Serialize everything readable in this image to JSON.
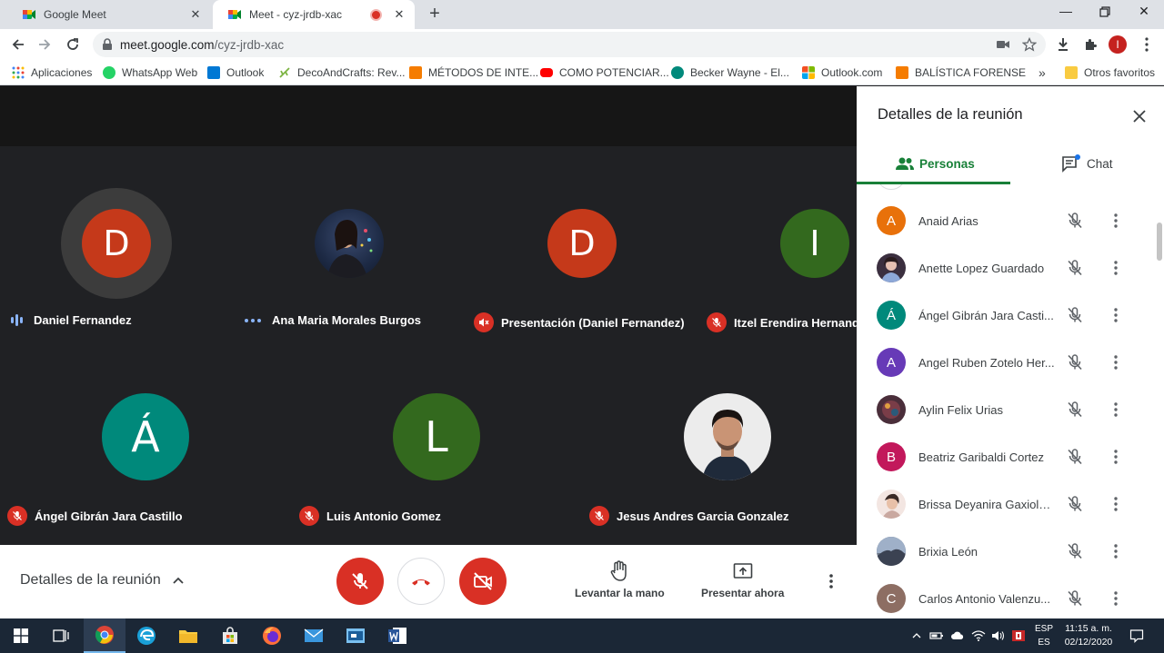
{
  "browser": {
    "tabs": [
      {
        "title": "Google Meet",
        "active": false
      },
      {
        "title": "Meet - cyz-jrdb-xac",
        "active": true,
        "recording": true
      }
    ],
    "url_host": "meet.google.com",
    "url_path": "/cyz-jrdb-xac",
    "profile_initial": "I",
    "bookmarks": [
      {
        "label": "Aplicaciones",
        "icon": "apps-grid-icon",
        "color": "#4285f4"
      },
      {
        "label": "WhatsApp Web",
        "icon": "whatsapp-icon",
        "color": "#25d366"
      },
      {
        "label": "Outlook",
        "icon": "outlook-icon",
        "color": "#0078d4"
      },
      {
        "label": "DecoAndCrafts: Rev...",
        "icon": "leaf-icon",
        "color": "#7cb342"
      },
      {
        "label": "MÉTODOS DE INTE...",
        "icon": "blogger-icon",
        "color": "#f57c00"
      },
      {
        "label": "COMO POTENCIAR...",
        "icon": "youtube-icon",
        "color": "#ff0000"
      },
      {
        "label": "Becker Wayne - El...",
        "icon": "globe-icon",
        "color": "#00897b"
      },
      {
        "label": "Outlook.com",
        "icon": "microsoft-icon",
        "color": "#f25022"
      },
      {
        "label": "BALÍSTICA FORENSE",
        "icon": "blogger-icon",
        "color": "#f57c00"
      }
    ],
    "more_bookmarks": "»",
    "other_bookmarks": "Otros favoritos"
  },
  "meet": {
    "tiles": [
      {
        "name": "Daniel Fernandez",
        "initial": "D",
        "color": "#c5391a",
        "status": "speaking"
      },
      {
        "name": "Ana Maria Morales Burgos",
        "initial": "",
        "color": "#243355",
        "status": "dots"
      },
      {
        "name": "Presentación (Daniel Fernandez)",
        "initial": "D",
        "color": "#c5391a",
        "status": "muted-presentation"
      },
      {
        "name": "Itzel Erendira Hernandez",
        "initial": "I",
        "color": "#33691e",
        "status": "muted"
      },
      {
        "name": "Ángel Gibrán Jara Castillo",
        "initial": "Á",
        "color": "#00897b",
        "status": "muted"
      },
      {
        "name": "Luis Antonio Gomez",
        "initial": "L",
        "color": "#33691e",
        "status": "muted"
      },
      {
        "name": "Jesus Andres Garcia Gonzalez",
        "initial": "",
        "color": "#e8e8e8",
        "status": "muted"
      }
    ],
    "controls": {
      "details_label": "Detalles de la reunión",
      "raise_hand_label": "Levantar la mano",
      "present_label": "Presentar ahora"
    }
  },
  "panel": {
    "title": "Detalles de la reunión",
    "tab_people": "Personas",
    "tab_chat": "Chat",
    "people": [
      {
        "name": "Anaid Arias",
        "initial": "A",
        "color": "#e8710a"
      },
      {
        "name": "Anette Lopez Guardado",
        "initial": "",
        "color": "#3b2f3f"
      },
      {
        "name": "Ángel Gibrán Jara Casti...",
        "initial": "Á",
        "color": "#00897b"
      },
      {
        "name": "Angel Ruben Zotelo Her...",
        "initial": "A",
        "color": "#673ab7"
      },
      {
        "name": "Aylin Felix Urias",
        "initial": "",
        "color": "#4a2e3a"
      },
      {
        "name": "Beatriz Garibaldi Cortez",
        "initial": "B",
        "color": "#c2185b"
      },
      {
        "name": "Brissa Deyanira Gaxiola ...",
        "initial": "",
        "color": "#d9c7c3"
      },
      {
        "name": "Brixia León",
        "initial": "",
        "color": "#6b7587"
      },
      {
        "name": "Carlos Antonio Valenzu...",
        "initial": "C",
        "color": "#8d6e63"
      }
    ]
  },
  "taskbar": {
    "lang_line1": "ESP",
    "lang_line2": "ES",
    "time": "11:15 a. m.",
    "date": "02/12/2020"
  }
}
